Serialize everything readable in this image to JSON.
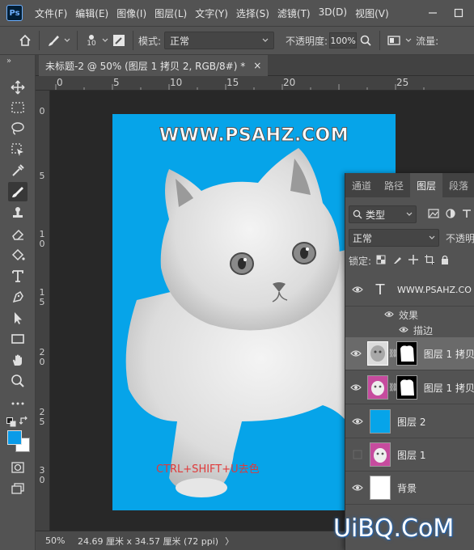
{
  "menu": {
    "logo": "Ps",
    "items": [
      "文件(F)",
      "编辑(E)",
      "图像(I)",
      "图层(L)",
      "文字(Y)",
      "选择(S)",
      "滤镜(T)",
      "3D(D)",
      "视图(V)"
    ]
  },
  "options": {
    "brush_size": "10",
    "mode_label": "模式:",
    "mode_value": "正常",
    "opacity_label": "不透明度:",
    "opacity_value": "100%",
    "flow_label": "流量:"
  },
  "tab": {
    "title": "未标题-2 @ 50% (图层 1 拷贝 2, RGB/8#) *",
    "close": "×"
  },
  "ruler": {
    "top": [
      "0",
      "5",
      "10",
      "15",
      "20",
      "25"
    ],
    "left": [
      "0",
      "5",
      "10",
      "15",
      "20",
      "25",
      "30"
    ]
  },
  "canvas": {
    "background_color": "#06a4e9",
    "watermark": "WWW.PSAHZ.COM",
    "shortcut": "CTRL+SHIFT+U去色"
  },
  "status": {
    "zoom": "50%",
    "doc_info": "24.69 厘米 x 34.57 厘米 (72 ppi)",
    "arrow": "〉"
  },
  "panel": {
    "tabs": [
      "通道",
      "路径",
      "图层",
      "段落"
    ],
    "filter_type": "类型",
    "blend_mode": "正常",
    "opacity_label": "不透明",
    "lock_label": "锁定:",
    "layers": [
      {
        "name": "WWW.PSAHZ.CO",
        "kind": "text"
      },
      {
        "name": "效果",
        "kind": "effect"
      },
      {
        "name": "描边",
        "kind": "effect-item"
      },
      {
        "name": "图层 1 拷贝",
        "kind": "masked",
        "selected": true
      },
      {
        "name": "图层 1 拷贝",
        "kind": "masked"
      },
      {
        "name": "图层 2",
        "kind": "fill"
      },
      {
        "name": "图层 1",
        "kind": "image"
      },
      {
        "name": "背景",
        "kind": "background"
      }
    ]
  },
  "site_watermark": "UiBQ.CoM",
  "colors": {
    "foreground": "#0a9be8",
    "background": "#ffffff",
    "accent": "#06a4e9"
  }
}
